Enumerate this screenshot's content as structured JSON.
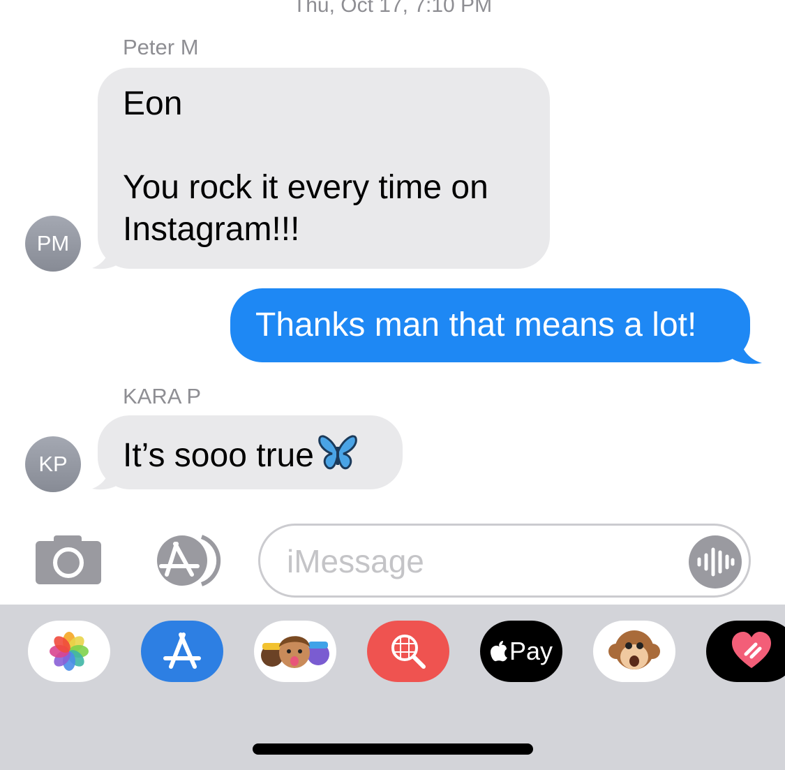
{
  "conversation": {
    "timestamp": "Thu, Oct 17, 7:10 PM",
    "messages": [
      {
        "sender_name": "Peter M",
        "avatar_initials": "PM",
        "lines": [
          "Eon",
          "",
          "You rock it every time on",
          "Instagram!!!"
        ]
      },
      {
        "outgoing": true,
        "text": "Thanks man that means a lot!"
      },
      {
        "sender_name": "KARA P",
        "avatar_initials": "KP",
        "text": "It’s sooo true",
        "emoji": "butterfly"
      }
    ]
  },
  "compose": {
    "camera_icon": "camera-icon",
    "apps_icon": "app-store-icon",
    "placeholder": "iMessage",
    "audio_icon": "audio-waveform-icon"
  },
  "app_drawer": {
    "apps": [
      {
        "icon": "photos-icon"
      },
      {
        "icon": "app-store-icon"
      },
      {
        "icon": "memoji-stickers-icon"
      },
      {
        "icon": "image-search-icon"
      },
      {
        "icon": "apple-pay-icon",
        "label": "Pay"
      },
      {
        "icon": "animoji-icon"
      },
      {
        "icon": "digital-touch-icon"
      }
    ]
  },
  "colors": {
    "outgoing_bubble": "#1e88f4",
    "incoming_bubble": "#e9e9eb",
    "drawer_background": "#d3d4d9"
  }
}
